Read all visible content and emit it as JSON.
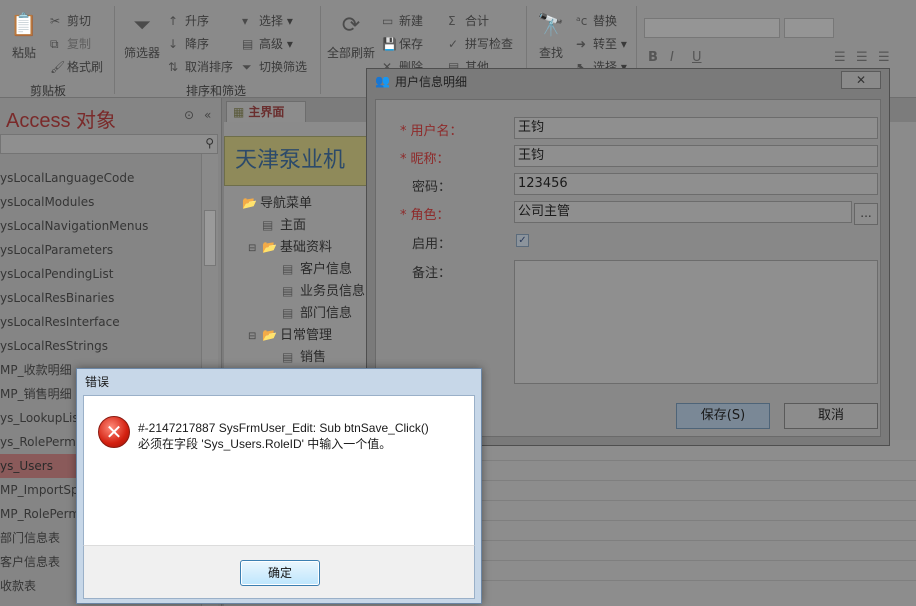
{
  "ribbon": {
    "clipboard": {
      "paste": "粘贴",
      "cut": "剪切",
      "copy": "复制",
      "format_painter": "格式刷",
      "group": "剪贴板"
    },
    "sort_filter": {
      "filter": "筛选器",
      "asc": "升序",
      "desc": "降序",
      "clear_sort": "取消排序",
      "select": "选择",
      "advanced": "高级",
      "toggle_filter": "切换筛选",
      "group": "排序和筛选"
    },
    "records": {
      "refresh_all": "全部刷新",
      "new": "新建",
      "save": "保存",
      "delete": "删除",
      "totals": "合计",
      "spelling": "拼写检查",
      "more": "其他"
    },
    "find": {
      "find": "查找",
      "replace": "替换",
      "goto": "转至",
      "select": "选择"
    }
  },
  "nav": {
    "title": "Access 对象",
    "items": [
      "ysLocalLanguageCode",
      "ysLocalModules",
      "ysLocalNavigationMenus",
      "ysLocalParameters",
      "ysLocalPendingList",
      "ysLocalResBinaries",
      "ysLocalResInterface",
      "ysLocalResStrings",
      "MP_收款明细",
      "MP_销售明细",
      "ys_LookupList",
      "ys_RolePerm",
      "ys_Users",
      "MP_ImportSp",
      "MP_RolePerm",
      "部门信息表",
      "客户信息表",
      "收款表"
    ],
    "selected_index": 12
  },
  "main": {
    "tab": "主界面",
    "banner": "天津泵业机",
    "tree": [
      {
        "label": "导航菜单",
        "type": "folder",
        "level": 0,
        "expander": ""
      },
      {
        "label": "主面",
        "type": "doc",
        "level": 1,
        "expander": ""
      },
      {
        "label": "基础资料",
        "type": "folder",
        "level": 1,
        "expander": "⊟"
      },
      {
        "label": "客户信息",
        "type": "doc",
        "level": 2,
        "expander": ""
      },
      {
        "label": "业务员信息",
        "type": "doc",
        "level": 2,
        "expander": ""
      },
      {
        "label": "部门信息",
        "type": "doc",
        "level": 2,
        "expander": ""
      },
      {
        "label": "日常管理",
        "type": "folder",
        "level": 1,
        "expander": "⊟"
      },
      {
        "label": "销售",
        "type": "doc",
        "level": 2,
        "expander": ""
      }
    ]
  },
  "user_dialog": {
    "title": "用户信息明细",
    "fields": {
      "username_label": "用户名：",
      "username": "王钧",
      "nickname_label": "昵称：",
      "nickname": "王钧",
      "password_label": "密码：",
      "password": "123456",
      "role_label": "角色：",
      "role": "公司主管",
      "enabled_label": "启用：",
      "enabled": true,
      "remarks_label": "备注："
    },
    "required_mark": "*",
    "dots": "...",
    "save": "保存(S)",
    "cancel": "取消"
  },
  "error_dialog": {
    "title": "错误",
    "line1": "#-2147217887 SysFrmUser_Edit: Sub btnSave_Click()",
    "line2": "必须在字段 'Sys_Users.RoleID' 中输入一个值。",
    "ok": "确定"
  }
}
